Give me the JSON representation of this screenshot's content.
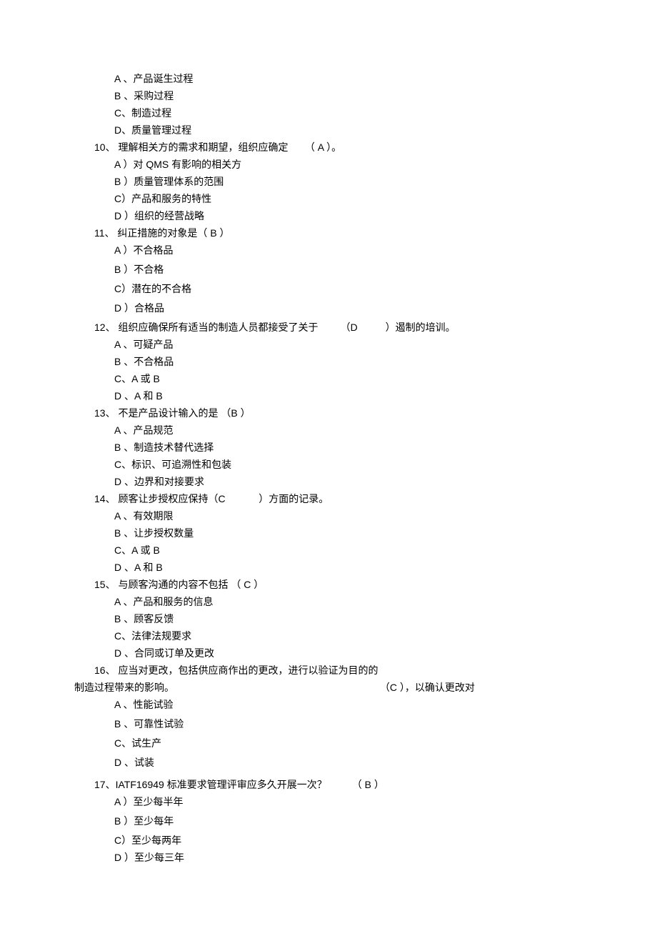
{
  "q9": {
    "optA": "A 、产品诞生过程",
    "optB": "B 、采购过程",
    "optC": "C、制造过程",
    "optD": "D、质量管理过程"
  },
  "q10": {
    "num": "10、",
    "text1": " 理解相关方的需求和期望，组织应确定",
    "ans": "（ A  ）",
    "text2": "。",
    "optA": "A ）对 QMS 有影响的相关方",
    "optB": "B ）质量管理体系的范围",
    "optC": "C）产品和服务的特性",
    "optD": "D ）组织的经营战略"
  },
  "q11": {
    "num": "11、",
    "text1": " 纠正措施的对象是（  B  ）",
    "optA": "A ）不合格品",
    "optB": "B ）不合格",
    "optC": "C）潜在的不合格",
    "optD": "D ）合格品"
  },
  "q12": {
    "num": "12、",
    "text1": " 组织应确保所有适当的制造人员都接受了关于",
    "ans": "（D",
    "text2": "）遏制的培训。",
    "optA": "A 、可疑产品",
    "optB": "B 、不合格品",
    "optC": "C、A 或  B",
    "optD": "D 、A 和  B"
  },
  "q13": {
    "num": "13、",
    "text1": " 不是产品设计输入的是   （B  ）",
    "optA": "A 、产品规范",
    "optB": "B 、制造技术替代选择",
    "optC": "C、标识、可追溯性和包装",
    "optD": "D 、边界和对接要求"
  },
  "q14": {
    "num": "14、",
    "text1": " 顾客让步授权应保持（C",
    "text2": "）方面的记录。",
    "optA": "A 、有效期限",
    "optB": "B 、让步授权数量",
    "optC": "C、A 或  B",
    "optD": "D 、A 和  B"
  },
  "q15": {
    "num": "15、",
    "text1": " 与顾客沟通的内容不包括   （ C  ）",
    "optA": "A 、产品和服务的信息",
    "optB": "B 、顾客反馈",
    "optC": "C、法律法规要求",
    "optD": "D 、合同或订单及更改"
  },
  "q16": {
    "num": "16、",
    "text1": " 应当对更改，包括供应商作出的更改，进行以验证为目的的",
    "line2a": "制造过程带来的影响。",
    "ans": "（C  ）",
    "text2": "，以确认更改对",
    "optA": "A 、性能试验",
    "optB": "B 、可靠性试验",
    "optC": "C、试生产",
    "optD": "D 、试装"
  },
  "q17": {
    "num": "17",
    "text1": "、IATF16949 标准要求管理评审应多久开展一次？",
    "ans": "（  B  ）",
    "optA": "A ）至少每半年",
    "optB": "B ）至少每年",
    "optC": "C）至少每两年",
    "optD": "D ）至少每三年"
  }
}
